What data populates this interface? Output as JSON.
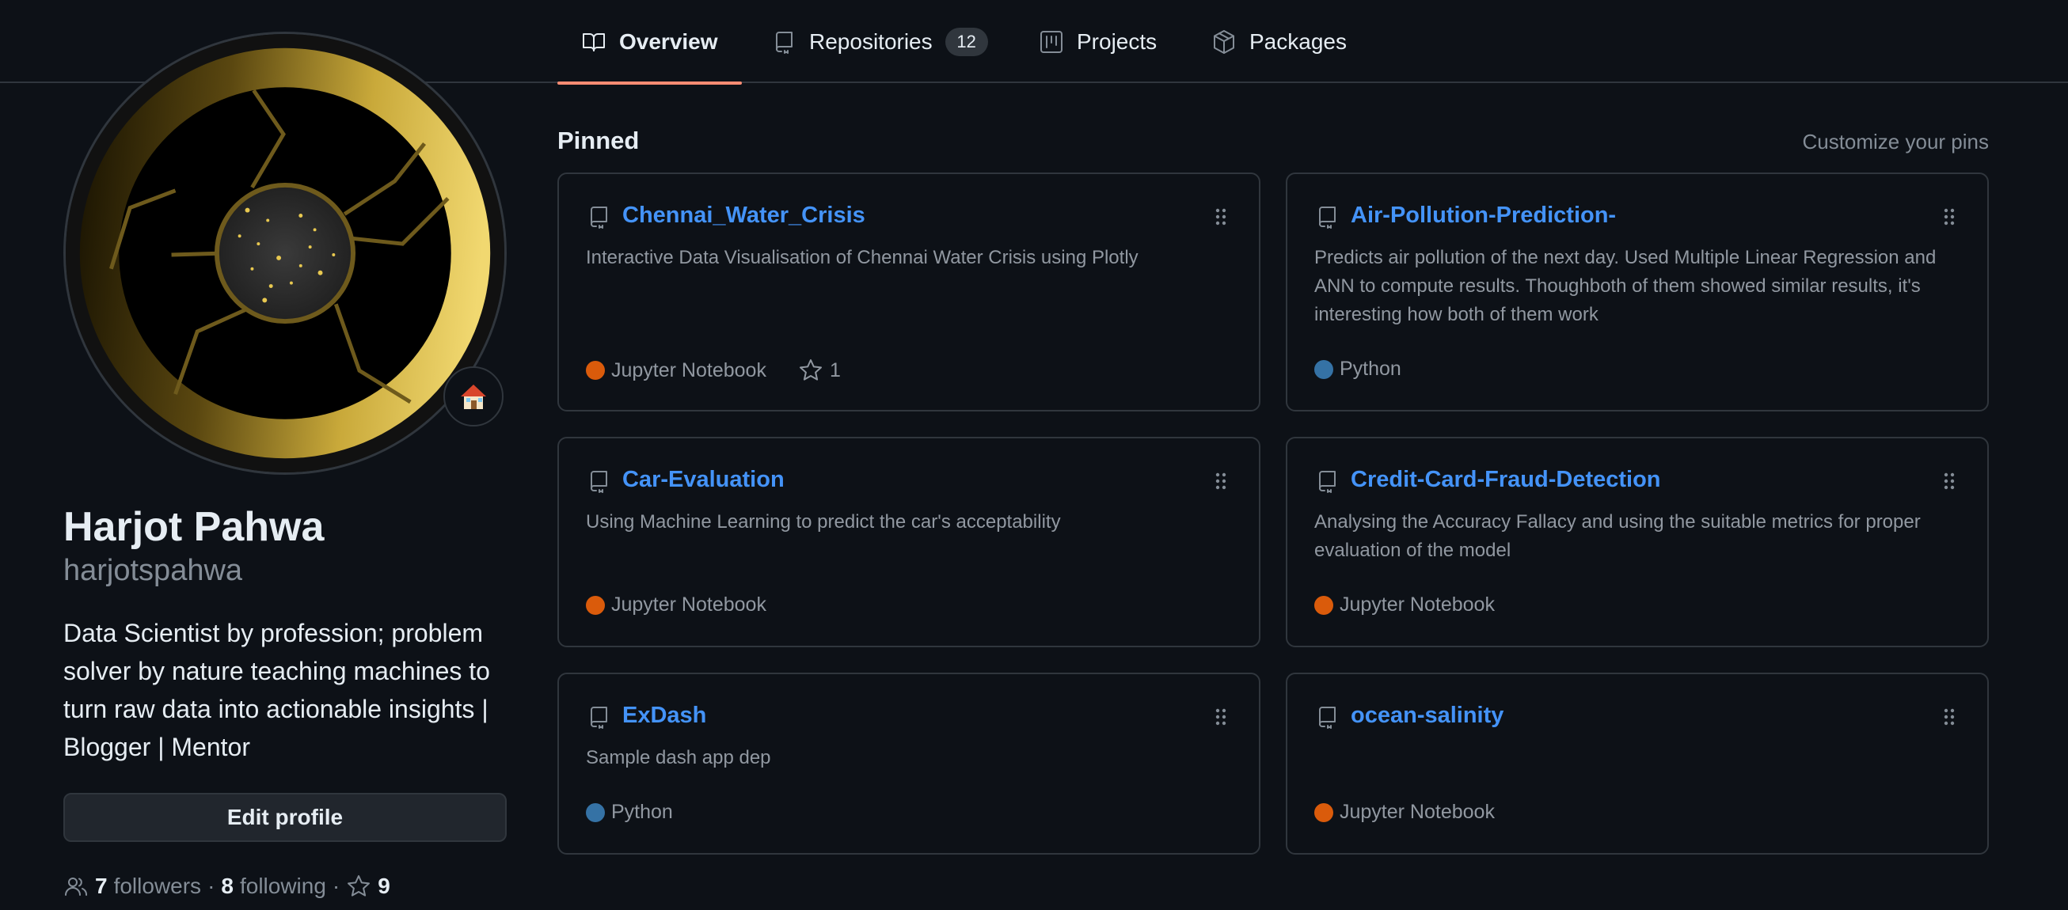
{
  "tabs": [
    {
      "label": "Overview",
      "icon": "book-icon",
      "selected": true
    },
    {
      "label": "Repositories",
      "icon": "repo-icon",
      "count": "12"
    },
    {
      "label": "Projects",
      "icon": "project-icon"
    },
    {
      "label": "Packages",
      "icon": "package-icon"
    }
  ],
  "profile": {
    "full_name": "Harjot Pahwa",
    "login": "harjotspahwa",
    "bio": "Data Scientist by profession; problem solver by nature teaching machines to turn raw data into actionable insights | Blogger | Mentor",
    "edit_label": "Edit profile",
    "status_emoji": "house-icon",
    "followers_count": "7",
    "followers_label": "followers",
    "following_count": "8",
    "following_label": "following",
    "stars_count": "9",
    "separator": "·"
  },
  "pinned": {
    "title": "Pinned",
    "customize_label": "Customize your pins",
    "repos": [
      {
        "name": "Chennai_Water_Crisis",
        "description": "Interactive Data Visualisation of Chennai Water Crisis using Plotly",
        "language": "Jupyter Notebook",
        "language_color": "#DA5B0B",
        "stars": "1"
      },
      {
        "name": "Air-Pollution-Prediction-",
        "description": "Predicts air pollution of the next day. Used Multiple Linear Regression and ANN to compute results. Thoughboth of them showed similar results, it's interesting how both of them work",
        "language": "Python",
        "language_color": "#3572A5"
      },
      {
        "name": "Car-Evaluation",
        "description": "Using Machine Learning to predict the car's acceptability",
        "language": "Jupyter Notebook",
        "language_color": "#DA5B0B"
      },
      {
        "name": "Credit-Card-Fraud-Detection",
        "description": "Analysing the Accuracy Fallacy and using the suitable metrics for proper evaluation of the model",
        "language": "Jupyter Notebook",
        "language_color": "#DA5B0B"
      },
      {
        "name": "ExDash",
        "description": "Sample dash app dep",
        "language": "Python",
        "language_color": "#3572A5"
      },
      {
        "name": "ocean-salinity",
        "description": "",
        "language": "Jupyter Notebook",
        "language_color": "#DA5B0B"
      }
    ]
  },
  "colors": {
    "accent": "#fd8c73",
    "link": "#4493f8",
    "background": "#0d1117",
    "border": "#30363d"
  }
}
